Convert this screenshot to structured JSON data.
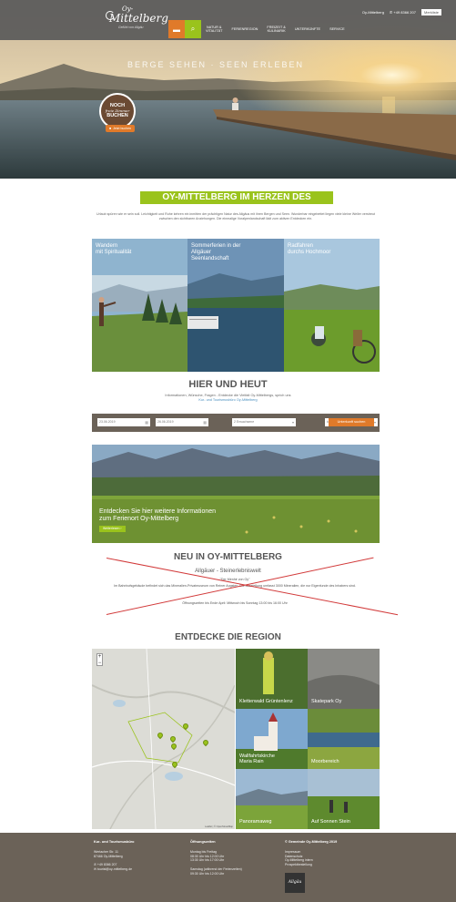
{
  "header": {
    "logo": {
      "line1": "Oy-",
      "line2": "Mittelberg",
      "line3": "Gefühl von Allgäu"
    },
    "topbar": {
      "location": "Oy-Mittelberg",
      "phone": "+49 8366 207",
      "button": "Merkliste"
    },
    "nav": [
      "NATUR &\nVITALITÄT",
      "FERIENREGION",
      "FREIZEIT &\nKULINARIK",
      "UNTERKÜNFTE",
      "SERVICE"
    ]
  },
  "hero": {
    "title": "BERGE SEHEN · SEEN ERLEBEN",
    "badge": {
      "line1": "NOCH",
      "line2": "freie Zimmer",
      "line3": "BUCHEN"
    },
    "badge_button": "Jetzt buchen"
  },
  "intro": {
    "title": "OY-MITTELBERG IM HERZEN DES ALLGÄUS",
    "text": "Urlaub spüren wie er sein soll. Leichtigkeit und Ruhe kehren ein inmitten der prächtigen Natur des Allgäus mit ihren Bergen und Seen. Wunderbar eingebettet liegen viele kleine Weiler verstreut zwischen den sichtbaren Anziehungen. Die einmalige Voralpenlandschaft lädt zum aktiven Entdecken ein."
  },
  "tiles": [
    {
      "caption": "Wandern\nmit Spiritualität"
    },
    {
      "caption": "Sommerferien in der\nAllgäuer\nSeenlandschaft"
    },
    {
      "caption": "Radfahren\ndurchs Hochmoor"
    }
  ],
  "hier_und_heut": {
    "title": "HIER UND HEUT",
    "text": "Informationen, Wünsche, Fragen - Entdecke die Vielfalt Oy-Mittelbergs, sprich uns",
    "link": "Kur- und Tourismusbüro Oy-Mittelberg"
  },
  "booking": {
    "arrival": "23.06.2019",
    "departure": "26.06.2019",
    "adults": "2 Erwachsene",
    "children": "keine Kinder",
    "submit": "Unterkunft suchen"
  },
  "info": {
    "text": "Entdecken Sie hier weitere Informationen\nzum Ferienort Oy-Mittelberg",
    "button": "Weiterlesen"
  },
  "neu": {
    "title": "NEU IN OY-MITTELBERG",
    "subtitle": "Allgäuer - Steinerlebniswelt",
    "line1": "\"Der Menhir von Oy\"",
    "line2": "Im Bahnhofsgebäude befindet sich das Mineralien-Privatmuseum von Reiner Augsten. Die Ausstellung umfasst 3000 Mineralien, die nur Eigenfunde des Inhabers sind.",
    "line3": "Öffnungszeiten bis Ende April: Mittwoch bis Sonntag 13:00 bis 16:00 Uhr"
  },
  "region": {
    "title": "ENTDECKE DIE REGION",
    "map_attribution": "Leaflet | © OpenStreetMap",
    "tiles": [
      "Kletterwald Grüntenlenz",
      "Skatepark Oy",
      "Wallfahrtskirche\nMaria Rain",
      "Moorbereich",
      "Panoramaweg",
      "Auf Sonnen Stein"
    ]
  },
  "footer": {
    "col1": {
      "heading": "Kur- und Tourismusbüro",
      "lines": [
        "Wertacher Str. 11",
        "87466 Oy-Mittelberg",
        "",
        "✆ +49 8366 207",
        "✉ tourist@oy-mittelberg.de"
      ]
    },
    "col2": {
      "heading": "Öffnungszeiten",
      "lines": [
        "Montag bis Freitag",
        "08:30 Uhr bis 12:00 Uhr",
        "13:30 Uhr bis 17:00 Uhr",
        "",
        "Samstag (während der Ferienzeiten)",
        "09:30 Uhr bis 12:00 Uhr"
      ]
    },
    "col3": {
      "heading": "© Gemeinde Oy-Mittelberg 2019",
      "lines": [
        "Impressum",
        "Datenschutz",
        "Oy-Mittelberg intern",
        "Prospektbestellung"
      ]
    },
    "badge": "Allgäu"
  },
  "colors": {
    "accent_green": "#9ac31c",
    "accent_orange": "#e07a2a",
    "footer": "#6b6258",
    "strike": "#d23a3a"
  }
}
